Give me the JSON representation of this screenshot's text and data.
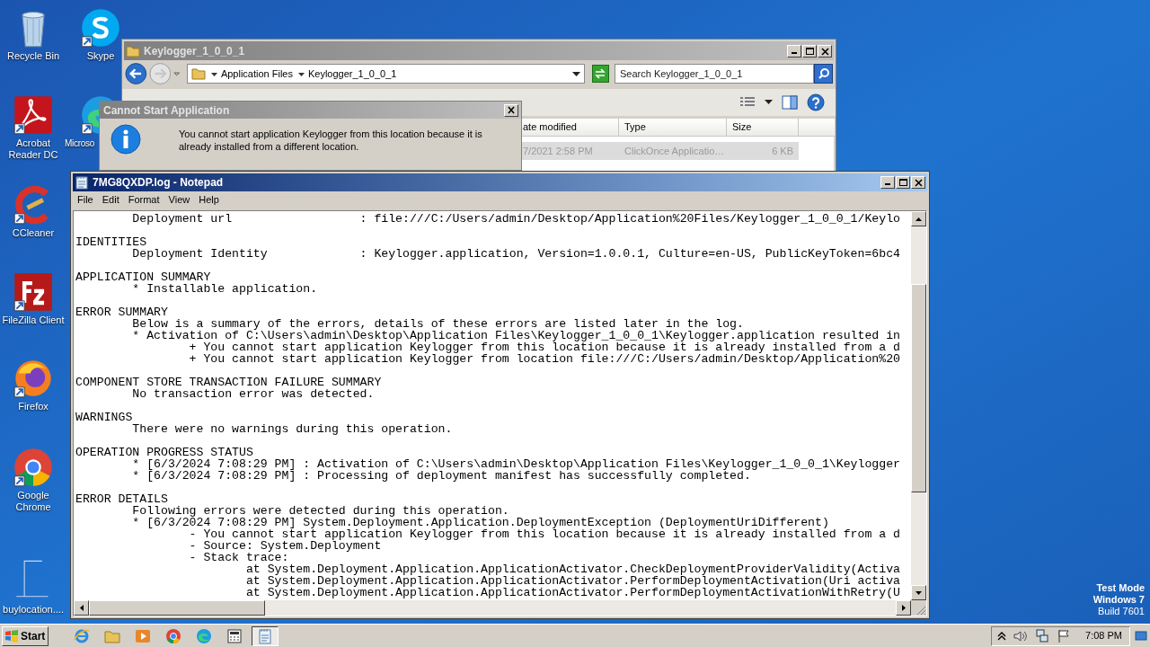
{
  "desktop": {
    "icons": [
      {
        "label": "Recycle Bin",
        "kind": "trash"
      },
      {
        "label": "Acrobat Reader DC",
        "kind": "pdf"
      },
      {
        "label": "CCleaner",
        "kind": "cleaner"
      },
      {
        "label": "FileZilla Client",
        "kind": "ftp"
      },
      {
        "label": "Firefox",
        "kind": "firefox"
      },
      {
        "label": "Google Chrome",
        "kind": "chrome"
      },
      {
        "label": "buylocation....",
        "kind": "file"
      },
      {
        "label": "Skype",
        "kind": "skype"
      },
      {
        "label": "Microso",
        "kind": "edge"
      }
    ],
    "system_text": [
      "Test Mode",
      "Windows 7",
      "Build 7601"
    ]
  },
  "explorer": {
    "title": "Keylogger_1_0_0_1",
    "breadcrumbs": [
      "Application Files",
      "Keylogger_1_0_0_1"
    ],
    "search": {
      "placeholder": "Search Keylogger_1_0_0_1"
    },
    "columns": [
      "ate modified",
      "Type",
      "Size"
    ],
    "rows": [
      {
        "cells": [
          "7/2021 2:58 PM",
          "ClickOnce Applicatio…",
          "6 KB"
        ],
        "selected": true
      }
    ]
  },
  "dialog": {
    "title": "Cannot Start Application",
    "message": "You cannot start application Keylogger from this location because it is already installed from a different location."
  },
  "notepad": {
    "title": "7MG8QXDP.log - Notepad",
    "menu": [
      "File",
      "Edit",
      "Format",
      "View",
      "Help"
    ],
    "blocks": [
      [
        "        Deployment url                  : file:///C:/Users/admin/Desktop/Application%20Files/Keylogger_1_0_0_1/Keylo"
      ],
      [
        "IDENTITIES",
        "        Deployment Identity             : Keylogger.application, Version=1.0.0.1, Culture=en-US, PublicKeyToken=6bc4"
      ],
      [
        "APPLICATION SUMMARY",
        "        * Installable application."
      ],
      [
        "ERROR SUMMARY",
        "        Below is a summary of the errors, details of these errors are listed later in the log.",
        "        * Activation of C:\\Users\\admin\\Desktop\\Application Files\\Keylogger_1_0_0_1\\Keylogger.application resulted in",
        "                + You cannot start application Keylogger from this location because it is already installed from a d",
        "                + You cannot start application Keylogger from location file:///C:/Users/admin/Desktop/Application%20"
      ],
      [
        "COMPONENT STORE TRANSACTION FAILURE SUMMARY",
        "        No transaction error was detected."
      ],
      [
        "WARNINGS",
        "        There were no warnings during this operation."
      ],
      [
        "OPERATION PROGRESS STATUS",
        "        * [6/3/2024 7:08:29 PM] : Activation of C:\\Users\\admin\\Desktop\\Application Files\\Keylogger_1_0_0_1\\Keylogger",
        "        * [6/3/2024 7:08:29 PM] : Processing of deployment manifest has successfully completed."
      ],
      [
        "ERROR DETAILS",
        "        Following errors were detected during this operation.",
        "        * [6/3/2024 7:08:29 PM] System.Deployment.Application.DeploymentException (DeploymentUriDifferent)",
        "                - You cannot start application Keylogger from this location because it is already installed from a d",
        "                - Source: System.Deployment",
        "                - Stack trace:",
        "                        at System.Deployment.Application.ApplicationActivator.CheckDeploymentProviderValidity(Activa",
        "                        at System.Deployment.Application.ApplicationActivator.PerformDeploymentActivation(Uri activa",
        "                        at System.Deployment.Application.ApplicationActivator.PerformDeploymentActivationWithRetry(U"
      ]
    ]
  },
  "taskbar": {
    "start": "Start",
    "apps": [
      {
        "kind": "ie",
        "active": false
      },
      {
        "kind": "folder",
        "active": false
      },
      {
        "kind": "media",
        "active": false
      },
      {
        "kind": "chrome",
        "active": false
      },
      {
        "kind": "edge",
        "active": false
      },
      {
        "kind": "calc",
        "active": false
      },
      {
        "kind": "notepad",
        "active": true
      }
    ],
    "clock": "7:08 PM"
  }
}
